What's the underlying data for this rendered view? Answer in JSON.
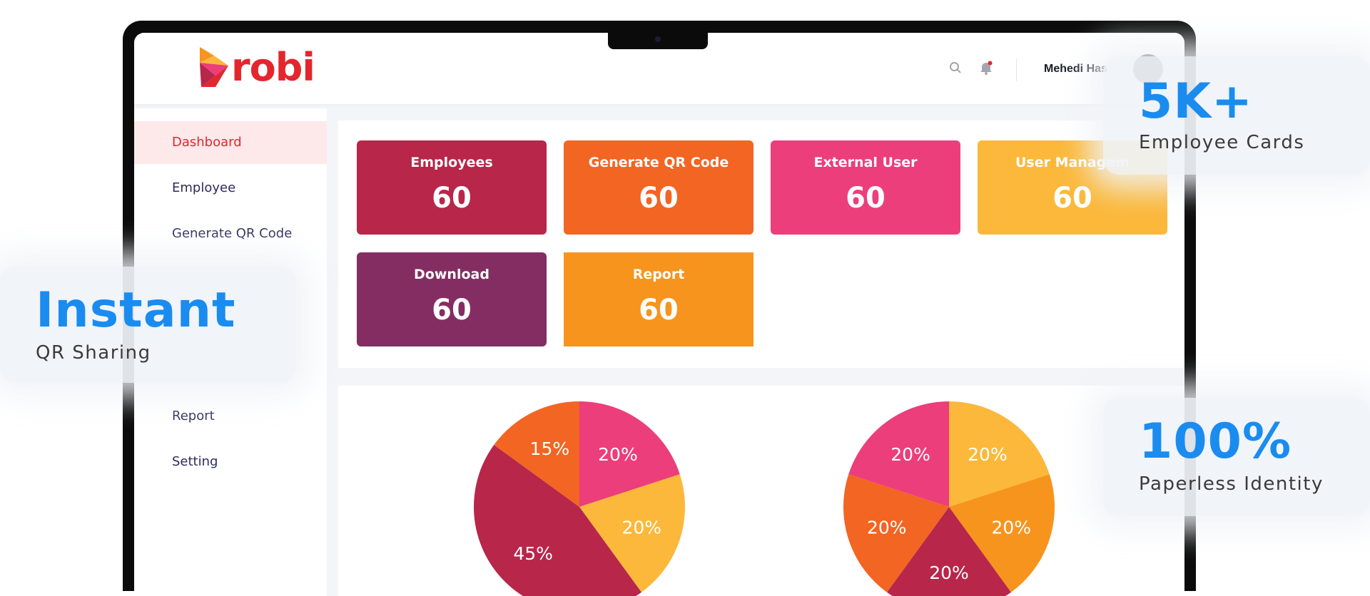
{
  "brand": {
    "name": "robi",
    "color": "#e3262d"
  },
  "header": {
    "search_icon": "search-icon",
    "bell_icon": "bell-icon",
    "user_name": "Mehedi Has"
  },
  "sidebar": {
    "items": [
      {
        "label": "Dashboard",
        "active": true
      },
      {
        "label": "Employee"
      },
      {
        "label": "Generate QR Code"
      },
      {
        "label": "Report"
      },
      {
        "label": "Setting"
      }
    ]
  },
  "cards": [
    {
      "title": "Employees",
      "value": "60",
      "color": "#b8264a"
    },
    {
      "title": "Generate QR Code",
      "value": "60",
      "color": "#f26522"
    },
    {
      "title": "External User",
      "value": "60",
      "color": "#ec3e7b"
    },
    {
      "title": "User Managem",
      "value": "60",
      "color": "#fbb83a"
    },
    {
      "title": "Download",
      "value": "60",
      "color": "#842d62"
    },
    {
      "title": "Report",
      "value": "60",
      "color": "#f7941e"
    }
  ],
  "chart_data": [
    {
      "type": "pie",
      "slices": [
        {
          "label": "20%",
          "value": 20,
          "color": "#ec3e7b"
        },
        {
          "label": "20%",
          "value": 20,
          "color": "#fbb83a"
        },
        {
          "label": "45%",
          "value": 45,
          "color": "#b8264a"
        },
        {
          "label": "15%",
          "value": 15,
          "color": "#f26522"
        }
      ]
    },
    {
      "type": "pie",
      "slices": [
        {
          "label": "20%",
          "value": 20,
          "color": "#fbb83a"
        },
        {
          "label": "20%",
          "value": 20,
          "color": "#f7941e"
        },
        {
          "label": "20%",
          "value": 20,
          "color": "#b8264a"
        },
        {
          "label": "20%",
          "value": 20,
          "color": "#f26522"
        },
        {
          "label": "20%",
          "value": 20,
          "color": "#ec3e7b"
        }
      ]
    }
  ],
  "badges": {
    "left": {
      "big": "Instant",
      "small": "QR Sharing"
    },
    "top_right": {
      "big": "5K+",
      "small": "Employee Cards"
    },
    "bottom_right": {
      "big": "100%",
      "small": "Paperless Identity"
    }
  },
  "colors": {
    "badge_accent": "#1a8cf0"
  }
}
